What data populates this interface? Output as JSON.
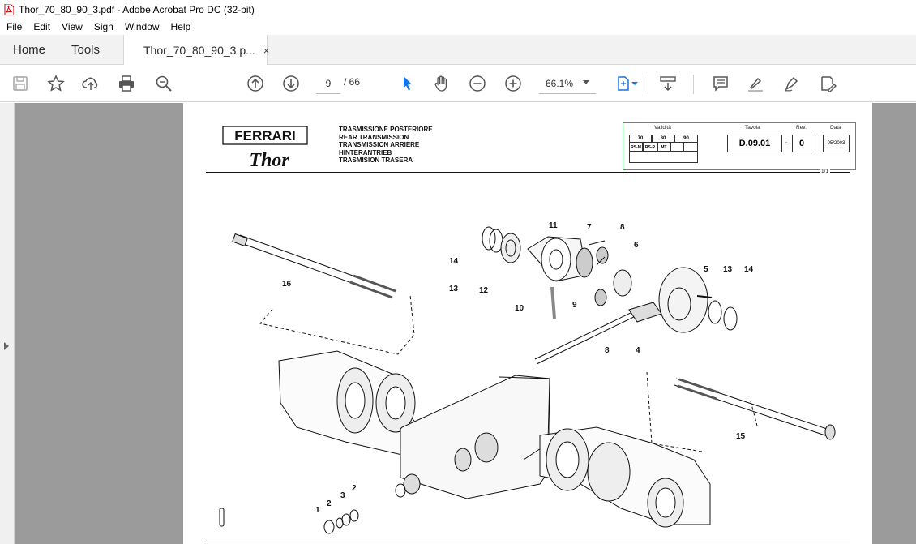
{
  "window": {
    "title": "Thor_70_80_90_3.pdf - Adobe Acrobat Pro DC (32-bit)"
  },
  "menu": [
    "File",
    "Edit",
    "View",
    "Sign",
    "Window",
    "Help"
  ],
  "tabs": {
    "home": "Home",
    "tools": "Tools",
    "document": "Thor_70_80_90_3.p...",
    "close": "×"
  },
  "toolbar": {
    "page_current": "9",
    "page_total": "/ 66",
    "zoom": "66.1%"
  },
  "icons": {
    "save": "save-icon",
    "bookmark": "star-icon",
    "upload": "upload-cloud-icon",
    "print": "print-icon",
    "search": "zoom-search-icon",
    "prev": "page-up-icon",
    "next": "page-down-icon",
    "select": "pointer-icon",
    "hand": "hand-icon",
    "zoom_out": "zoom-out-icon",
    "zoom_in": "zoom-in-icon"
  },
  "document": {
    "brand": "FERRARI",
    "model": "Thor",
    "title_lines": [
      "TRASMISSIONE POSTERIORE",
      "REAR TRANSMISSION",
      "TRANSMISSION ARRIERE",
      "HINTERANTRIEB",
      "TRASMISION TRASERA"
    ],
    "validity_label": "Validità",
    "validity_cols": [
      "70",
      "80",
      "90"
    ],
    "validity_codes": [
      "RS-M",
      "RS-R",
      "MT"
    ],
    "tavola_label": "Tavola",
    "tavola_value": "D.09.01",
    "dash": "-",
    "rev_label": "Rev.",
    "rev_value": "0",
    "data_label": "Data",
    "data_value": "05/2003",
    "sheet": "1/1",
    "part_numbers": [
      "16",
      "14",
      "13",
      "12",
      "11",
      "7",
      "8",
      "6",
      "10",
      "9",
      "5",
      "13",
      "14",
      "8",
      "4",
      "15",
      "1",
      "2",
      "3",
      "2"
    ]
  },
  "colors": {
    "accent": "#2fa84f",
    "viewer_bg": "#9b9b9b",
    "icon_blue": "#1473e6"
  }
}
